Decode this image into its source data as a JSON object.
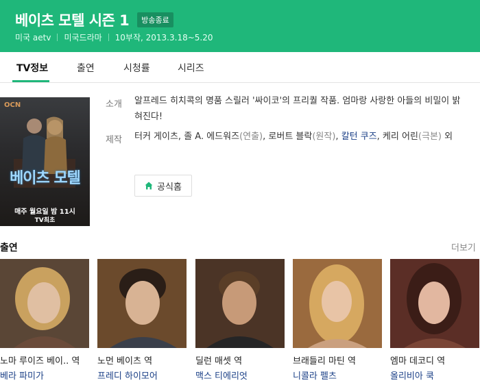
{
  "header": {
    "title": "베이츠 모텔 시즌 1",
    "badge": "방송종료",
    "meta": [
      "미국 aetv",
      "미국드라마",
      "10부작, 2013.3.18~5.20"
    ]
  },
  "tabs": [
    "TV정보",
    "출연",
    "시청률",
    "시리즈"
  ],
  "poster": {
    "network": "OCN",
    "title": "베이츠 모텔",
    "line1": "매주 월요일 밤 11시",
    "line2": "TV최초"
  },
  "info": {
    "synopsis_label": "소개",
    "synopsis": "알프레드 히치콕의 명품 스릴러 '싸이코'의 프리퀄 작품. 엄마랑 사랑한 아들의 비밀이 밝혀진다!",
    "production_label": "제작",
    "production": {
      "p1": "터커 게이츠, 졸 A. 에드워즈",
      "p1_role": "(연출)",
      "p2": ", 로버트 블락",
      "p2_role": "(원작)",
      "p3": ", ",
      "p3_link": "칼턴 쿠즈",
      "p4": ", 케리 어린",
      "p4_role": "(극본)",
      "p5": " 외"
    },
    "home_button": "공식홈"
  },
  "cast": {
    "title": "출연",
    "more": "더보기",
    "members": [
      {
        "role": "노마 루이즈 베이.. 역",
        "actor": "베라 파미가"
      },
      {
        "role": "노먼 베이츠 역",
        "actor": "프레디 하이모어"
      },
      {
        "role": "딜런 매셋 역",
        "actor": "맥스 티에리엇"
      },
      {
        "role": "브래들리 마틴 역",
        "actor": "니콜라 펠츠"
      },
      {
        "role": "엠마 데코디 역",
        "actor": "올리비아 쿡"
      }
    ]
  }
}
